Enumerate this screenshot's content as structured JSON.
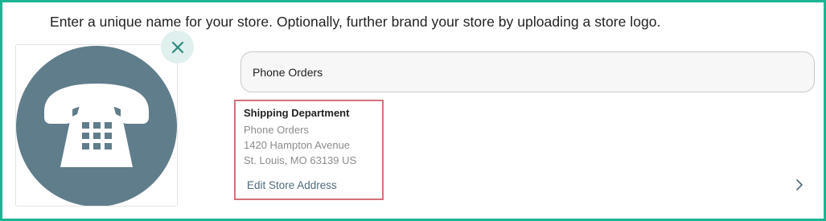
{
  "instructions": "Enter a unique name for your store. Optionally, further brand your store by uploading a store logo.",
  "logo": {
    "icon": "telephone-icon",
    "circle_color": "#607d8b",
    "glyph_color": "#ffffff"
  },
  "remove_logo": {
    "icon": "close-icon",
    "background": "#dff0ee",
    "icon_color": "#2b8a7e"
  },
  "store_name": {
    "value": "Phone Orders"
  },
  "address": {
    "name": "Shipping Department",
    "line1": "Phone Orders",
    "line2": "1420 Hampton Avenue",
    "line3": "St. Louis, MO 63139 US",
    "edit_label": "Edit Store Address"
  },
  "navigation": {
    "icon": "chevron-right-icon"
  },
  "colors": {
    "frame_border": "#1bb594",
    "highlight_border": "#d5707a",
    "link": "#4f6b7a"
  }
}
